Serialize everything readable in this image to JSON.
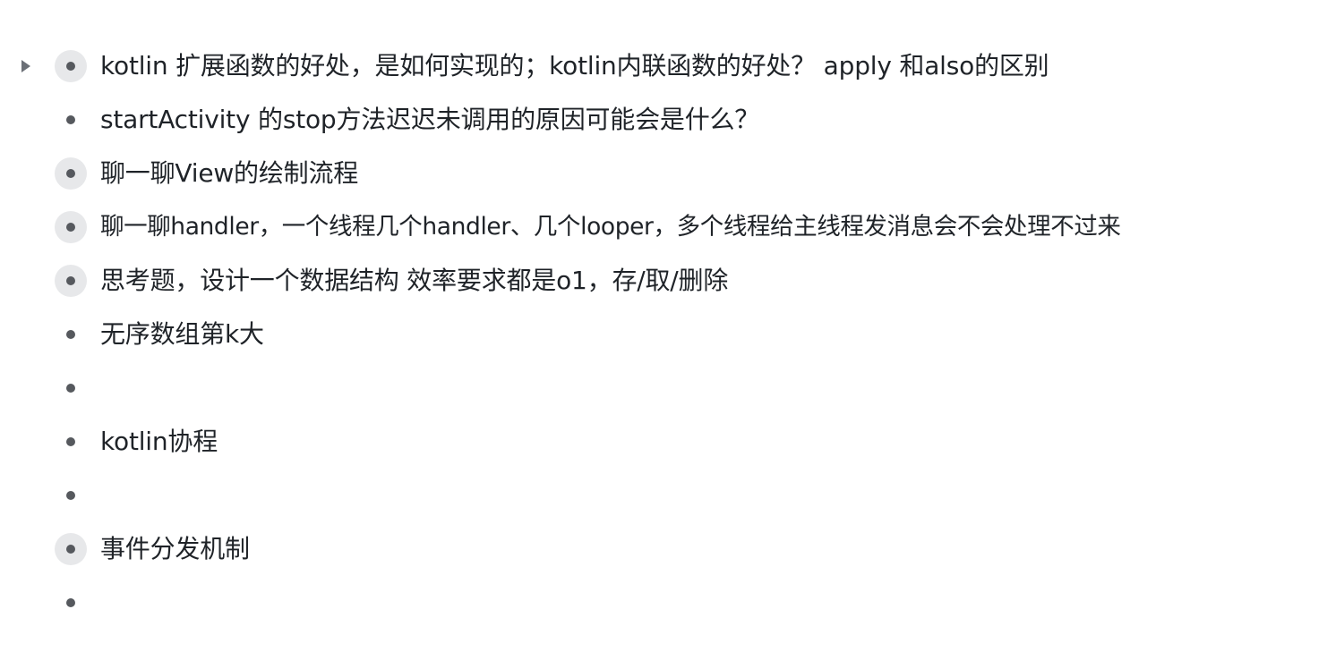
{
  "outline": {
    "items": [
      {
        "text": "kotlin 扩展函数的好处，是如何实现的；kotlin内联函数的好处？ apply 和also的区别",
        "collapsed": true,
        "toggle": "caret-right-icon"
      },
      {
        "text": "startActivity 的stop方法迟迟未调用的原因可能会是什么？",
        "collapsed": false
      },
      {
        "text": "聊一聊View的绘制流程",
        "collapsed": true
      },
      {
        "text": "聊一聊handler，一个线程几个handler、几个looper，多个线程给主线程发消息会不会处理不过来",
        "collapsed": true
      },
      {
        "text": "思考题，设计一个数据结构 效率要求都是o1，存/取/删除",
        "collapsed": true
      },
      {
        "text": "无序数组第k大",
        "collapsed": false
      },
      {
        "text": "",
        "collapsed": false
      },
      {
        "text": "kotlin协程",
        "collapsed": false
      },
      {
        "text": "",
        "collapsed": false
      },
      {
        "text": "事件分发机制",
        "collapsed": true
      },
      {
        "text": "",
        "collapsed": false
      }
    ]
  }
}
